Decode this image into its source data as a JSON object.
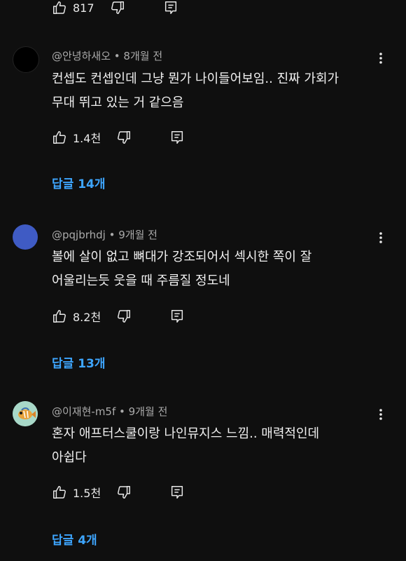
{
  "top_actions": {
    "like_count": "817"
  },
  "comments": [
    {
      "author": "@안녕하새오",
      "time": "8개월 전",
      "text_line1": "컨셉도 컨셉인데 그냥 뭔가 나이들어보임.. 진짜 가회가",
      "text_line2": "무대 뛰고 있는 거 같으음",
      "like_count": "1.4천",
      "replies_label": "답글 14개",
      "avatar_color": "#000000"
    },
    {
      "author": "@pqjbrhdj",
      "time": "9개월 전",
      "text_line1": "볼에 살이 없고 뼈대가 강조되어서 섹시한 쪽이 잘",
      "text_line2": "어울리는듯 웃을 때 주름질 정도네",
      "like_count": "8.2천",
      "replies_label": "답글 13개",
      "avatar_color": "#3f5bc4"
    },
    {
      "author": "@이재현-m5f",
      "time": "9개월 전",
      "text_line1": "혼자 애프터스쿨이랑 나인뮤지스 느낌.. 매력적인데",
      "text_line2": "아쉽다",
      "like_count": "1.5천",
      "replies_label": "답글 4개",
      "avatar_color": "#a8d8c8"
    }
  ],
  "colors": {
    "background": "#0f0f0f",
    "text": "#f1f1f1",
    "meta": "#aaaaaa",
    "link": "#3ea6ff"
  },
  "icons": [
    "thumbs-up-icon",
    "thumbs-down-icon",
    "reply-icon",
    "more-vert-icon"
  ]
}
